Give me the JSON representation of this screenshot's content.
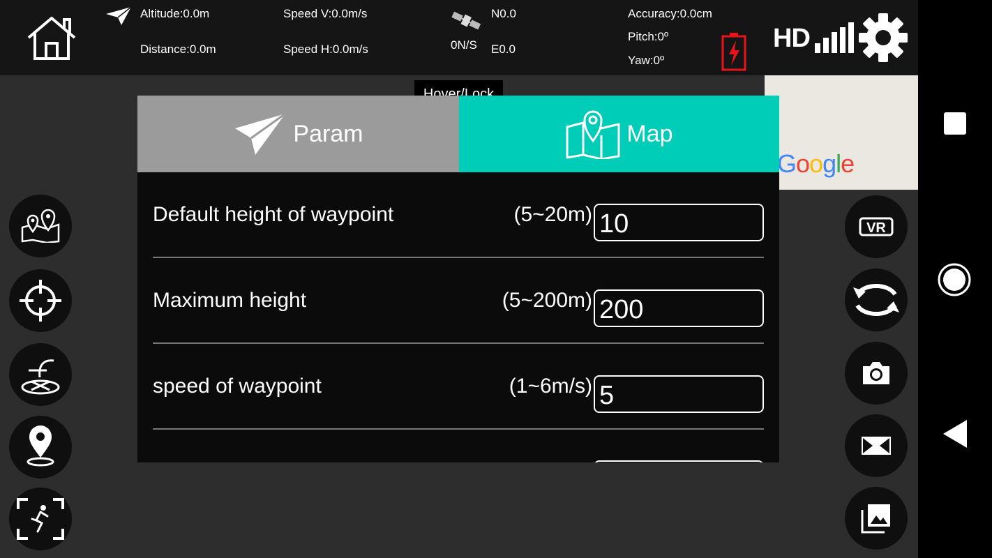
{
  "status_bar": {
    "altitude": "Altitude:0.0m",
    "distance": "Distance:0.0m",
    "speed_v": "Speed V:0.0m/s",
    "speed_h": "Speed H:0.0m/s",
    "gps_ns": "0N/S",
    "north": "N0.0",
    "east": "E0.0",
    "accuracy": "Accuracy:0.0cm",
    "pitch": "Pitch:0º",
    "yaw": "Yaw:0º",
    "hd_label": "HD",
    "battery_color": "#e8141a"
  },
  "hover_lock": "Hover/Lock",
  "map_thumb": {
    "brand_letters": [
      "G",
      "o",
      "o",
      "g",
      "l",
      "e"
    ],
    "brand_colors": [
      "#4285f4",
      "#ea4335",
      "#fbbc05",
      "#4285f4",
      "#34a853",
      "#ea4335"
    ]
  },
  "panel": {
    "tabs": [
      {
        "label": "Param",
        "icon": "paper-plane-icon",
        "active": false,
        "color": "#9b9b9b"
      },
      {
        "label": "Map",
        "icon": "map-pin-icon",
        "active": true,
        "color": "#00cdb8"
      }
    ],
    "rows": [
      {
        "label": "Default height of waypoint",
        "range": "(5~20m)",
        "value": "10"
      },
      {
        "label": "Maximum height",
        "range": "(5~200m)",
        "value": "200"
      },
      {
        "label": "speed of waypoint",
        "range": "(1~6m/s)",
        "value": "5"
      }
    ]
  },
  "left_buttons": [
    "waypoint-map-icon",
    "target-crosshair-icon",
    "takeoff-land-icon",
    "location-pin-icon",
    "follow-me-icon"
  ],
  "right_buttons": [
    "vr-icon",
    "rotate-camera-icon",
    "camera-icon",
    "video-icon",
    "gallery-icon"
  ],
  "android_nav": [
    "recents-square-icon",
    "home-circle-icon",
    "back-triangle-icon"
  ]
}
